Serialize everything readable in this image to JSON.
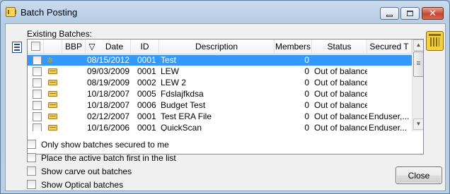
{
  "window": {
    "title": "Batch Posting"
  },
  "section_label": "Existing Batches:",
  "columns": {
    "bbp": "BBP",
    "sort_glyph": "▽",
    "date": "Date",
    "id": "ID",
    "description": "Description",
    "members": "Members",
    "status": "Status",
    "secured": "Secured T"
  },
  "rows": [
    {
      "date": "08/15/2012",
      "id": "0001",
      "description": "Test",
      "members": "0",
      "status": "",
      "secured": "",
      "selected": true
    },
    {
      "date": "09/03/2009",
      "id": "0001",
      "description": "LEW",
      "members": "0",
      "status": "Out of balance",
      "secured": ""
    },
    {
      "date": "08/19/2009",
      "id": "0002",
      "description": "LEW 2",
      "members": "0",
      "status": "Out of balance",
      "secured": ""
    },
    {
      "date": "10/18/2007",
      "id": "0005",
      "description": "Fdslajfkdsa",
      "members": "0",
      "status": "Out of balance",
      "secured": ""
    },
    {
      "date": "10/18/2007",
      "id": "0006",
      "description": "Budget Test",
      "members": "0",
      "status": "Out of balance",
      "secured": ""
    },
    {
      "date": "02/12/2007",
      "id": "0001",
      "description": "Test ERA File",
      "members": "0",
      "status": "Out of balance",
      "secured": "Enduser,..."
    },
    {
      "date": "10/16/2006",
      "id": "0001",
      "description": "QuickScan",
      "members": "0",
      "status": "Out of balance",
      "secured": "Enduser..."
    }
  ],
  "options": [
    {
      "label": "Only show batches secured to me",
      "checked": false
    },
    {
      "label": "Place the active batch first in the list",
      "checked": false
    },
    {
      "label": "Show carve out batches",
      "checked": false
    },
    {
      "label": "Show Optical batches",
      "checked": false
    }
  ],
  "close_label": "Close",
  "colors": {
    "selection": "#3399ff",
    "chrome": "#b9cfe5"
  }
}
